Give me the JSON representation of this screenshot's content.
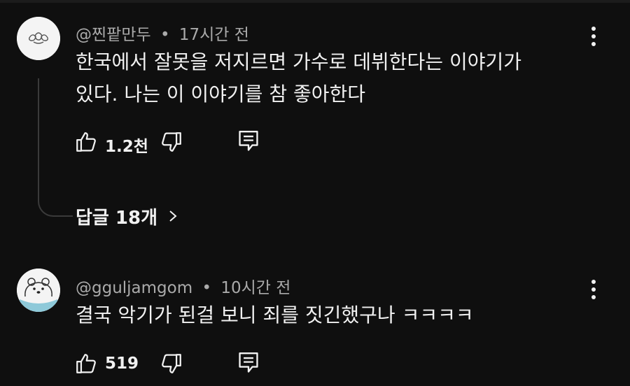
{
  "comments": [
    {
      "author": "@찐팥만두",
      "time": "17시간 전",
      "text_lines": [
        "한국에서 잘못을 저지르면 가수로 데뷔한다는 이야기가",
        "있다. 나는 이 이야기를 참 좋아한다"
      ],
      "likes": "1.2천",
      "replies_label": "답글 18개",
      "avatar_icon": "dumpling-icon"
    },
    {
      "author": "@gguljamgom",
      "time": "10시간 전",
      "text_lines": [
        "결국 악기가 된걸 보니 죄를 짓긴했구나 ㅋㅋㅋㅋ"
      ],
      "likes": "519",
      "avatar_icon": "polar-bear-icon"
    }
  ],
  "separator": "•",
  "icons": {
    "like": "thumbs-up-icon",
    "dislike": "thumbs-down-icon",
    "reply": "reply-icon",
    "more": "more-vertical-icon",
    "chevron": "chevron-right-icon"
  },
  "colors": {
    "background": "#0f0f0f",
    "text": "#f1f1f1",
    "secondary_text": "#aaaaaa",
    "thread_line": "#3a3a3a"
  }
}
